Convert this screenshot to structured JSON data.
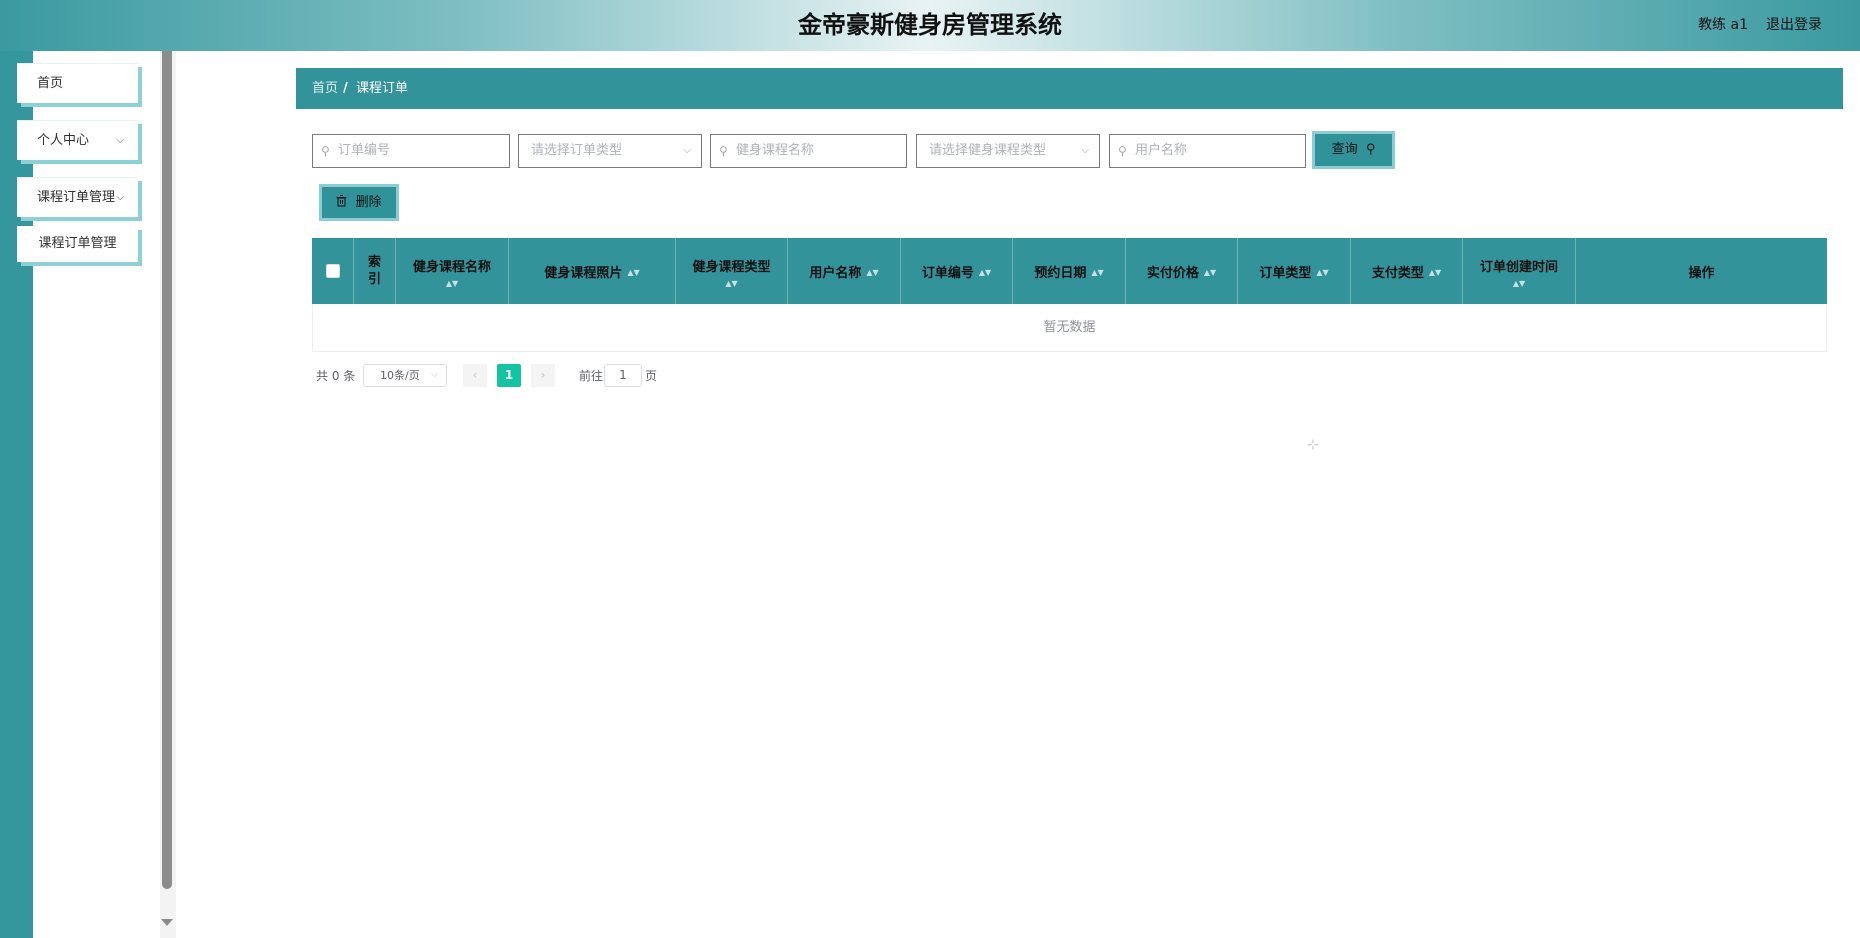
{
  "header": {
    "title": "金帝豪斯健身房管理系统",
    "user": "教练 a1",
    "logout": "退出登录"
  },
  "sidebar": {
    "items": [
      {
        "label": "首页"
      },
      {
        "label": "个人中心",
        "chevron": "⌵"
      },
      {
        "label": "课程订单管理",
        "chevron": "⌵"
      }
    ],
    "submenu": [
      {
        "label": "课程订单管理"
      }
    ]
  },
  "breadcrumb": {
    "home": "首页",
    "separator": "/",
    "current": "课程订单"
  },
  "search": {
    "order_no_placeholder": "订单编号",
    "order_type_placeholder": "请选择订单类型",
    "course_name_placeholder": "健身课程名称",
    "course_type_placeholder": "请选择健身课程类型",
    "user_name_placeholder": "用户名称",
    "query_label": "查询",
    "search_glyph": "⚲",
    "arrow_glyph": "⌵"
  },
  "actions": {
    "delete_label": "删除",
    "delete_icon": "trash-icon"
  },
  "table": {
    "columns": [
      {
        "label": "索引"
      },
      {
        "label": "健身课程名称"
      },
      {
        "label": "健身课程照片"
      },
      {
        "label": "健身课程类型"
      },
      {
        "label": "用户名称"
      },
      {
        "label": "订单编号"
      },
      {
        "label": "预约日期"
      },
      {
        "label": "实付价格"
      },
      {
        "label": "订单类型"
      },
      {
        "label": "支付类型"
      },
      {
        "label": "订单创建时间"
      },
      {
        "label": "操作"
      }
    ],
    "sort_glyph": "▲▼",
    "empty_text": "暂无数据"
  },
  "pagination": {
    "total_text": "共 0 条",
    "page_size": "10条/页",
    "prev": "‹",
    "next": "›",
    "current_page": "1",
    "goto_label": "前往",
    "goto_value": "1",
    "page_suffix": "页"
  },
  "colors": {
    "primary": "#33939a",
    "accent_shadow": "#8dcdd2",
    "active_page": "#13c4a3"
  }
}
